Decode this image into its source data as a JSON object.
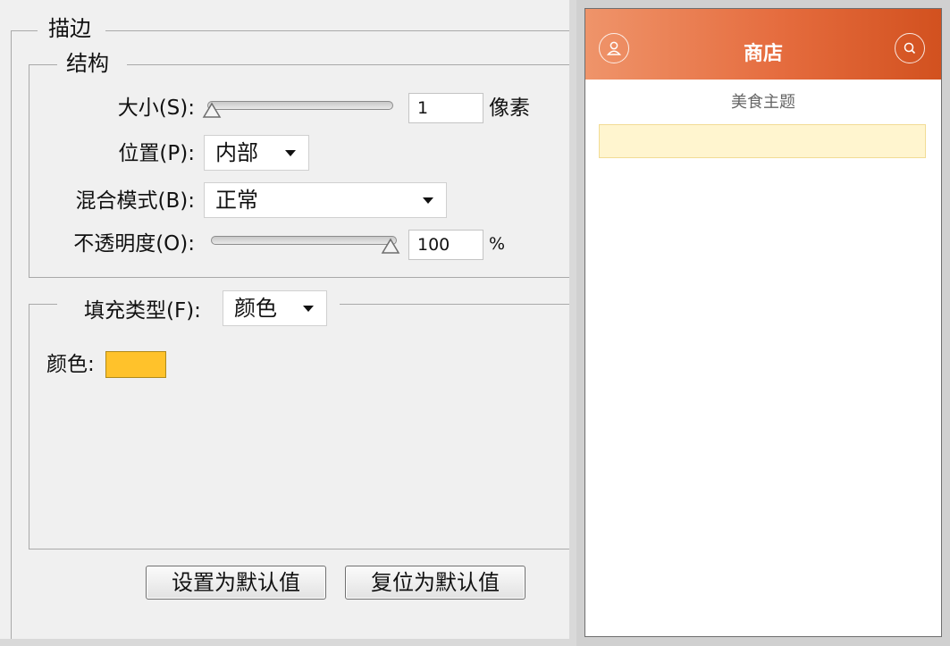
{
  "stroke_panel": {
    "title": "描边",
    "structure": {
      "title": "结构",
      "size_label": "大小(S):",
      "size_value": "1",
      "size_unit": "像素",
      "position_label": "位置(P):",
      "position_value": "内部",
      "blend_label": "混合模式(B):",
      "blend_value": "正常",
      "opacity_label": "不透明度(O):",
      "opacity_value": "100",
      "opacity_unit": "%"
    },
    "fill": {
      "type_label": "填充类型(F):",
      "type_value": "颜色",
      "color_label": "颜色:",
      "color_hex": "#ffc22b"
    },
    "buttons": {
      "set_default": "设置为默认值",
      "reset_default": "复位为默认值"
    }
  },
  "phone_preview": {
    "header_title": "商店",
    "subtitle": "美食主题",
    "left_icon": "user-icon",
    "right_icon": "search-icon",
    "header_color_start": "#ef946a",
    "header_color_end": "#d2511f",
    "notice_bar_color": "#fff5cf"
  }
}
